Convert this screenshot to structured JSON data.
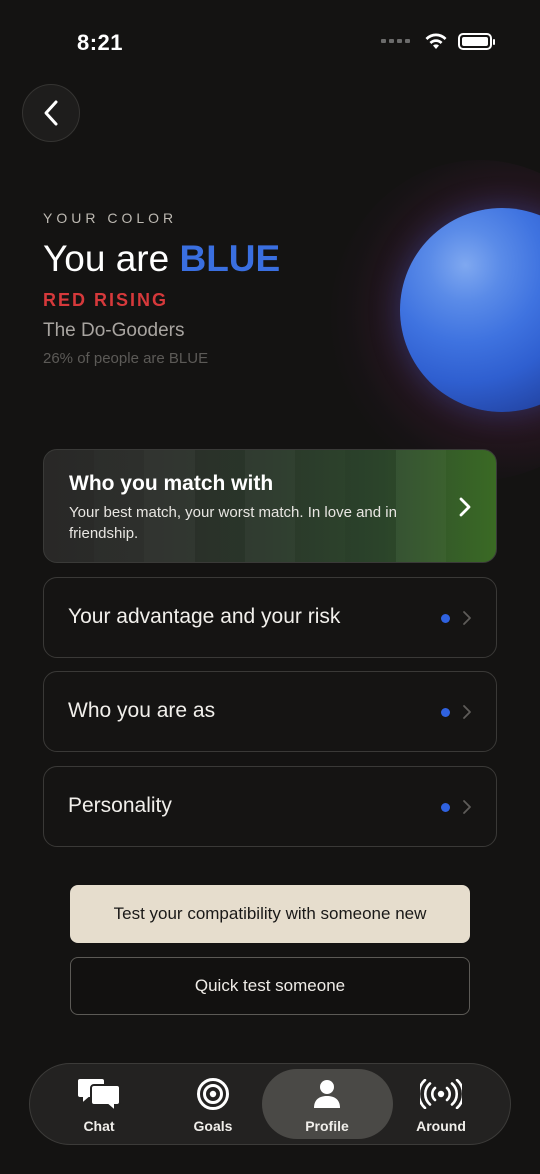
{
  "status_bar": {
    "time": "8:21"
  },
  "header": {
    "your_color_label": "YOUR COLOR",
    "headline_prefix": "You are ",
    "headline_color": "BLUE",
    "rising": "RED RISING",
    "group_name": "The Do-Gooders",
    "percent_text": "26% of people are BLUE"
  },
  "colors": {
    "accent_blue": "#3a6fe0",
    "rising_red": "#d6393b",
    "dot_blue": "#2f62e0",
    "primary_button": "#e6ddcd"
  },
  "match_card": {
    "title": "Who you match with",
    "description": "Your best match, your worst match. In love and in friendship."
  },
  "list": [
    {
      "label": "Your advantage and your risk",
      "has_dot": true
    },
    {
      "label": "Who you are as",
      "has_dot": true
    },
    {
      "label": "Personality",
      "has_dot": true
    }
  ],
  "buttons": {
    "primary": "Test your compatibility with someone new",
    "secondary": "Quick test someone"
  },
  "tabbar": {
    "tabs": [
      {
        "label": "Chat",
        "icon": "chat-bubbles-icon",
        "active": false
      },
      {
        "label": "Goals",
        "icon": "target-icon",
        "active": false
      },
      {
        "label": "Profile",
        "icon": "person-icon",
        "active": true
      },
      {
        "label": "Around",
        "icon": "broadcast-icon",
        "active": false
      }
    ]
  }
}
